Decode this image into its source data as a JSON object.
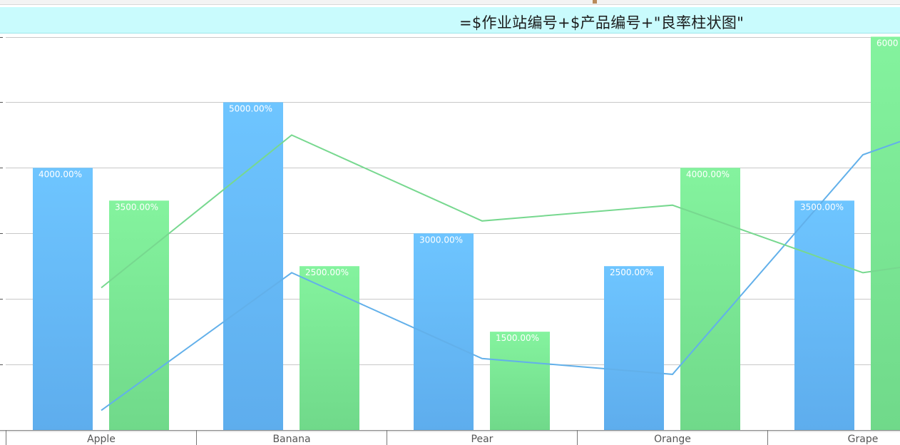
{
  "title": "=$作业站编号+$产品编号+\"良率柱状图\"",
  "chart_data": {
    "type": "bar",
    "categories": [
      "Apple",
      "Banana",
      "Pear",
      "Orange",
      "Grape"
    ],
    "ylim": [
      0,
      6000
    ],
    "grid": true,
    "series": [
      {
        "values": [
          4000,
          5000,
          3000,
          2500,
          3500
        ],
        "labels": [
          "4000.00%",
          "5000.00%",
          "3000.00%",
          "2500.00%",
          "3500.00%"
        ],
        "color": "#6ec2fd"
      },
      {
        "values": [
          3500,
          2500,
          1500,
          4000,
          6000
        ],
        "labels": [
          "3500.00%",
          "2500.00%",
          "1500.00%",
          "4000.00%",
          "6000"
        ],
        "color": "#80f19f"
      }
    ],
    "lines": [
      {
        "type": "line",
        "values": [
          300,
          2400,
          1090,
          850,
          4200,
          4400
        ],
        "color": "#62b0ea"
      },
      {
        "type": "line",
        "values": [
          2170,
          4500,
          3190,
          3430,
          2400,
          2480
        ],
        "color": "#77d88f"
      }
    ]
  }
}
